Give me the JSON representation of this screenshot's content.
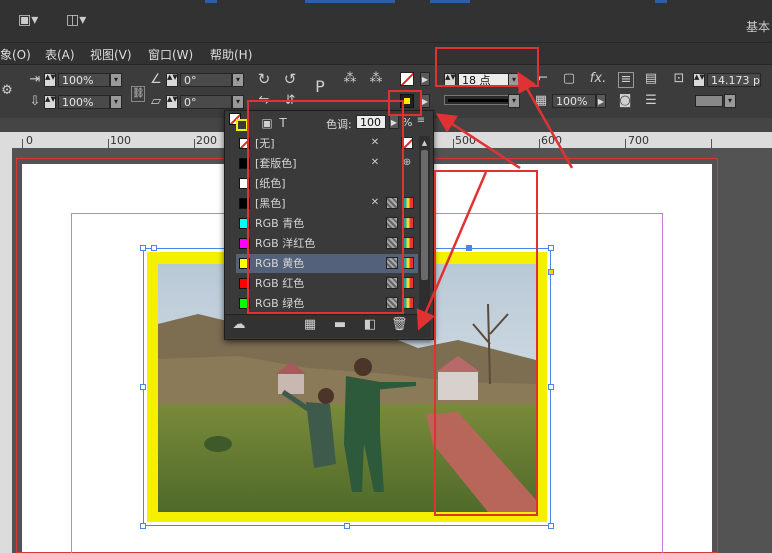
{
  "appbar": {
    "workspace_label": "基本"
  },
  "menubar": {
    "items": [
      "象(O)",
      "表(A)",
      "视图(V)",
      "窗口(W)",
      "帮助(H)"
    ]
  },
  "control": {
    "scale_x": "100%",
    "scale_y": "100%",
    "rotate": "0°",
    "shear": "0°",
    "stroke_weight": "18 点",
    "offset_value": "14.173 p",
    "opacity": "100%"
  },
  "ruler": {
    "labels": [
      "0",
      "100",
      "200",
      "500",
      "600",
      "700"
    ]
  },
  "swatches": {
    "tint_label": "色调:",
    "tint_value": "100",
    "tint_unit": "%",
    "rows": [
      {
        "name": "[无]",
        "color": "none"
      },
      {
        "name": "[套版色]",
        "color": "#000000"
      },
      {
        "name": "[纸色]",
        "color": "#ffffff"
      },
      {
        "name": "[黑色]",
        "color": "#000000"
      },
      {
        "name": "RGB 青色",
        "color": "#00ffff"
      },
      {
        "name": "RGB 洋红色",
        "color": "#ff00ff"
      },
      {
        "name": "RGB 黄色",
        "color": "#ffff00",
        "selected": true
      },
      {
        "name": "RGB 红色",
        "color": "#ff0000"
      },
      {
        "name": "RGB 绿色",
        "color": "#00ff00"
      }
    ]
  },
  "colors": {
    "annotation_red": "#e03232",
    "frame_yellow": "#f4f000",
    "selection_blue": "#4a86e8"
  }
}
